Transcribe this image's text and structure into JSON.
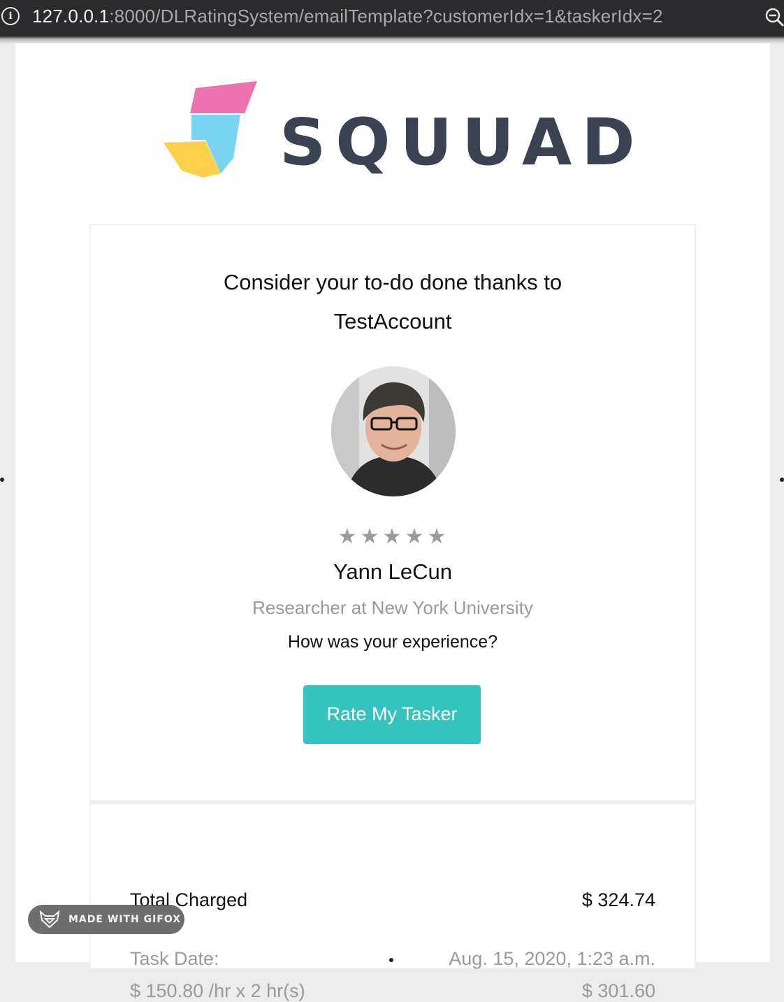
{
  "browser": {
    "url_host": "127.0.0.1",
    "url_rest": ":8000/DLRatingSystem/emailTemplate?customerIdx=1&taskerIdx=2",
    "info_icon": "info-icon",
    "zoom_icon": "zoom-icon"
  },
  "brand": {
    "wordmark": "SQUUAD",
    "colors": {
      "pink": "#ee72ad",
      "cyan": "#79d3f1",
      "yellow": "#fcd04a",
      "text": "#3b4353"
    }
  },
  "card": {
    "headline_line1": "Consider your to-do done thanks to",
    "headline_line2": "TestAccount",
    "rating": {
      "value": 5,
      "max": 5,
      "star_color": "#9b9b9b"
    },
    "tasker_name": "Yann LeCun",
    "tasker_role": "Researcher at New York University",
    "question": "How was your experience?",
    "button_label": "Rate My Tasker",
    "button_color": "#35c3c0"
  },
  "summary": {
    "total_label": "Total Charged",
    "total_value": "$ 324.74",
    "date_label": "Task Date:",
    "date_value": "Aug. 15, 2020, 1:23 a.m.",
    "rate_label": "$ 150.80 /hr x 2 hr(s)",
    "rate_value": "$ 301.60"
  },
  "overlay": {
    "gifox_label": "MADE WITH GIFOX"
  }
}
